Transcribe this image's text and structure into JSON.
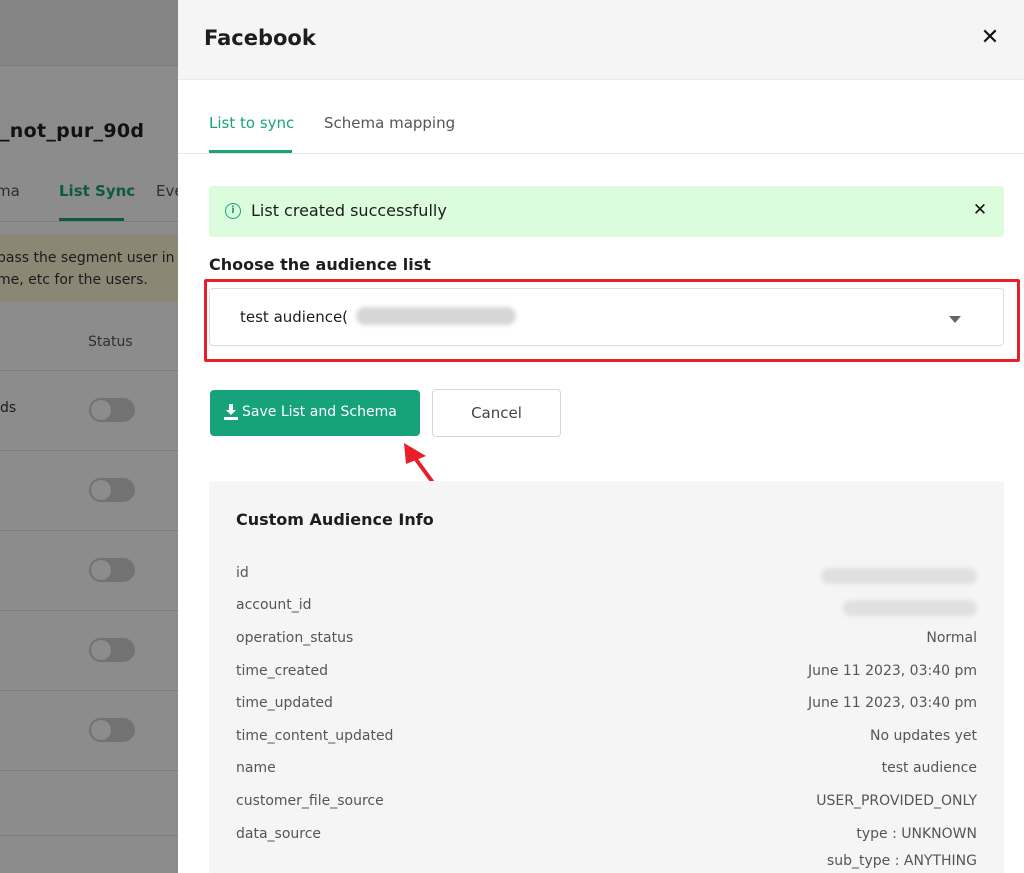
{
  "background": {
    "title": "_not_pur_90d",
    "tabs": [
      {
        "label": "ma"
      },
      {
        "label": "List Sync"
      },
      {
        "label": "Eve"
      }
    ],
    "notice_lines": [
      "pass the segment user in",
      "me, etc for the users."
    ],
    "status_header": "Status",
    "row_text": "ds"
  },
  "drawer": {
    "title": "Facebook",
    "close_icon": "close-icon"
  },
  "tabs": [
    {
      "label": "List to sync",
      "active": true
    },
    {
      "label": "Schema mapping",
      "active": false
    }
  ],
  "alert": {
    "icon": "info-icon",
    "text": "List created successfully",
    "close_icon": "close-icon"
  },
  "audience": {
    "label": "Choose the audience list",
    "selected": "test audience("
  },
  "buttons": {
    "save": "Save List and Schema",
    "save_icon": "download-icon",
    "cancel": "Cancel"
  },
  "info": {
    "title": "Custom Audience Info",
    "rows": [
      {
        "key": "id",
        "value": ""
      },
      {
        "key": "account_id",
        "value": ""
      },
      {
        "key": "operation_status",
        "value": "Normal"
      },
      {
        "key": "time_created",
        "value": "June 11 2023, 03:40 pm"
      },
      {
        "key": "time_updated",
        "value": "June 11 2023, 03:40 pm"
      },
      {
        "key": "time_content_updated",
        "value": "No updates yet"
      },
      {
        "key": "name",
        "value": "test audience"
      },
      {
        "key": "customer_file_source",
        "value": "USER_PROVIDED_ONLY"
      },
      {
        "key": "data_source",
        "value": "type : UNKNOWN",
        "value2": "sub_type : ANYTHING"
      }
    ]
  },
  "colors": {
    "accent": "#16a37b",
    "alert_bg": "#dcfcde",
    "highlight": "#e5202b"
  }
}
